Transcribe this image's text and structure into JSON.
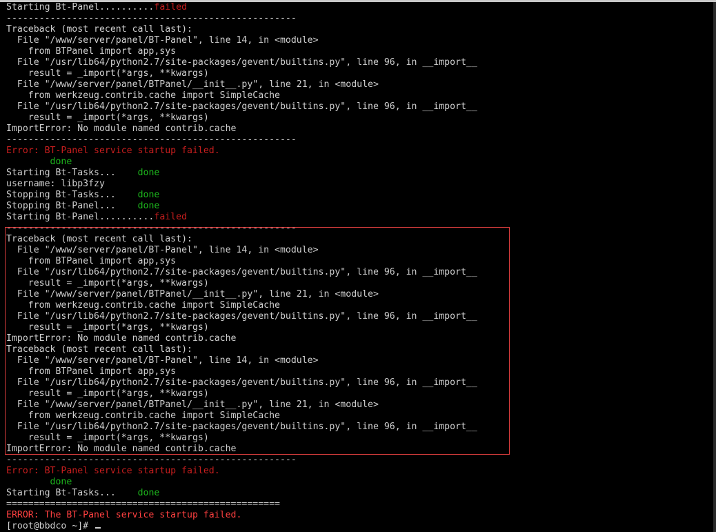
{
  "terminal": {
    "lines": [
      [
        {
          "t": "Starting Bt-Panel.........."
        },
        {
          "t": "failed",
          "c": "red"
        }
      ],
      [
        {
          "t": "-----------------------------------------------------"
        }
      ],
      [
        {
          "t": "Traceback (most recent call last):"
        }
      ],
      [
        {
          "t": "  File \"/www/server/panel/BT-Panel\", line 14, in <module>"
        }
      ],
      [
        {
          "t": "    from BTPanel import app,sys"
        }
      ],
      [
        {
          "t": "  File \"/usr/lib64/python2.7/site-packages/gevent/builtins.py\", line 96, in __import__"
        }
      ],
      [
        {
          "t": "    result = _import(*args, **kwargs)"
        }
      ],
      [
        {
          "t": "  File \"/www/server/panel/BTPanel/__init__.py\", line 21, in <module>"
        }
      ],
      [
        {
          "t": "    from werkzeug.contrib.cache import SimpleCache"
        }
      ],
      [
        {
          "t": "  File \"/usr/lib64/python2.7/site-packages/gevent/builtins.py\", line 96, in __import__"
        }
      ],
      [
        {
          "t": "    result = _import(*args, **kwargs)"
        }
      ],
      [
        {
          "t": "ImportError: No module named contrib.cache"
        }
      ],
      [
        {
          "t": "-----------------------------------------------------"
        }
      ],
      [
        {
          "t": "Error: BT-Panel service startup failed.",
          "c": "red"
        }
      ],
      [
        {
          "t": "        "
        },
        {
          "t": "done",
          "c": "green"
        }
      ],
      [
        {
          "t": "Starting Bt-Tasks...    "
        },
        {
          "t": "done",
          "c": "green"
        }
      ],
      [
        {
          "t": "username: libp3fzy"
        }
      ],
      [
        {
          "t": "Stopping Bt-Tasks...    "
        },
        {
          "t": "done",
          "c": "green"
        }
      ],
      [
        {
          "t": "Stopping Bt-Panel...    "
        },
        {
          "t": "done",
          "c": "green"
        }
      ],
      [
        {
          "t": "Starting Bt-Panel.........."
        },
        {
          "t": "failed",
          "c": "red"
        }
      ],
      [
        {
          "t": "-----------------------------------------------------"
        }
      ],
      [
        {
          "t": "Traceback (most recent call last):"
        }
      ],
      [
        {
          "t": "  File \"/www/server/panel/BT-Panel\", line 14, in <module>"
        }
      ],
      [
        {
          "t": "    from BTPanel import app,sys"
        }
      ],
      [
        {
          "t": "  File \"/usr/lib64/python2.7/site-packages/gevent/builtins.py\", line 96, in __import__"
        }
      ],
      [
        {
          "t": "    result = _import(*args, **kwargs)"
        }
      ],
      [
        {
          "t": "  File \"/www/server/panel/BTPanel/__init__.py\", line 21, in <module>"
        }
      ],
      [
        {
          "t": "    from werkzeug.contrib.cache import SimpleCache"
        }
      ],
      [
        {
          "t": "  File \"/usr/lib64/python2.7/site-packages/gevent/builtins.py\", line 96, in __import__"
        }
      ],
      [
        {
          "t": "    result = _import(*args, **kwargs)"
        }
      ],
      [
        {
          "t": "ImportError: No module named contrib.cache"
        }
      ],
      [
        {
          "t": "Traceback (most recent call last):"
        }
      ],
      [
        {
          "t": "  File \"/www/server/panel/BT-Panel\", line 14, in <module>"
        }
      ],
      [
        {
          "t": "    from BTPanel import app,sys"
        }
      ],
      [
        {
          "t": "  File \"/usr/lib64/python2.7/site-packages/gevent/builtins.py\", line 96, in __import__"
        }
      ],
      [
        {
          "t": "    result = _import(*args, **kwargs)"
        }
      ],
      [
        {
          "t": "  File \"/www/server/panel/BTPanel/__init__.py\", line 21, in <module>"
        }
      ],
      [
        {
          "t": "    from werkzeug.contrib.cache import SimpleCache"
        }
      ],
      [
        {
          "t": "  File \"/usr/lib64/python2.7/site-packages/gevent/builtins.py\", line 96, in __import__"
        }
      ],
      [
        {
          "t": "    result = _import(*args, **kwargs)"
        }
      ],
      [
        {
          "t": "ImportError: No module named contrib.cache"
        }
      ],
      [
        {
          "t": "-----------------------------------------------------"
        }
      ],
      [
        {
          "t": "Error: BT-Panel service startup failed.",
          "c": "red"
        }
      ],
      [
        {
          "t": "        "
        },
        {
          "t": "done",
          "c": "green"
        }
      ],
      [
        {
          "t": "Starting Bt-Tasks...    "
        },
        {
          "t": "done",
          "c": "green"
        }
      ],
      [
        {
          "t": "=================================================="
        }
      ],
      [
        {
          "t": "ERROR: The BT-Panel service startup failed.",
          "c": "red-bright"
        }
      ]
    ],
    "prompt": "[root@bbdco ~]# ",
    "colors": {
      "background": "#000000",
      "text": "#cfcfcf",
      "error": "#c81e1e",
      "error_bright": "#ff4040",
      "success": "#1db81d",
      "highlight_border": "#d83c3c"
    }
  }
}
